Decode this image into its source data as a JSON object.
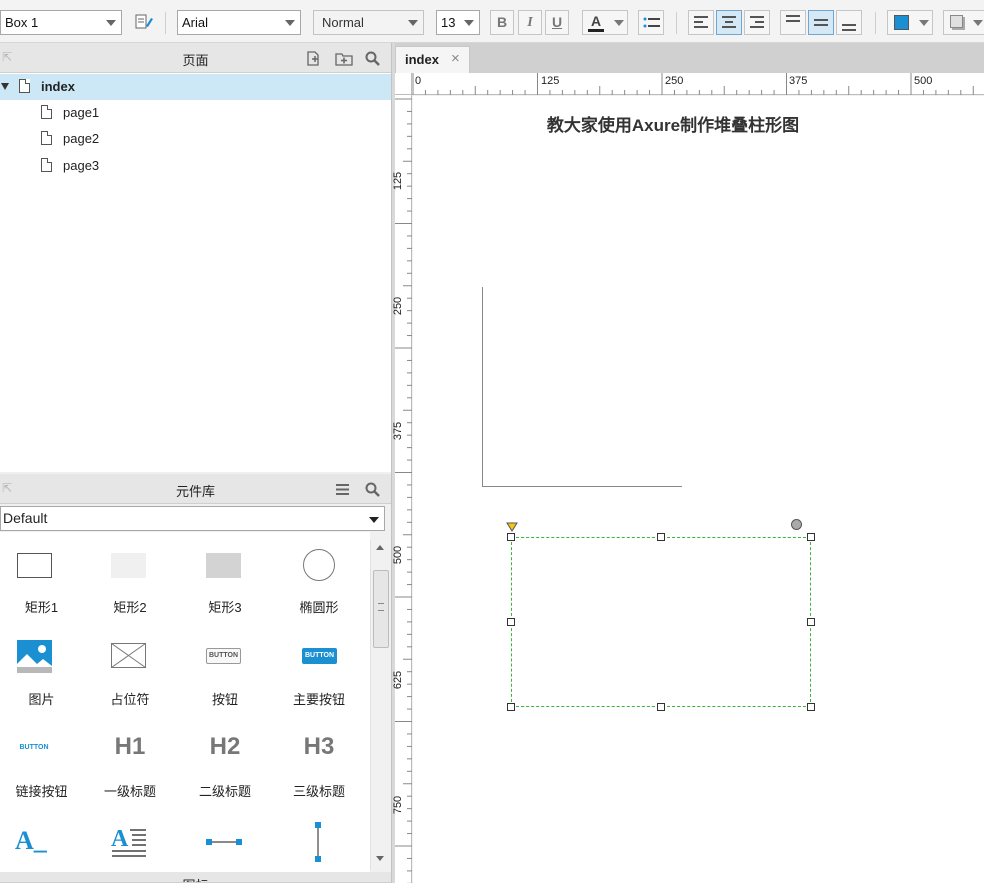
{
  "toolbar": {
    "widget_name": "Box 1",
    "font_family": "Arial",
    "font_style": "Normal",
    "font_size": "13",
    "bold": "B",
    "italic": "I",
    "underline": "U",
    "font_color": "A",
    "fill_color": "#1a8fd1"
  },
  "pages_panel": {
    "title": "页面",
    "root": "index",
    "children": [
      "page1",
      "page2",
      "page3"
    ]
  },
  "library_panel": {
    "title": "元件库",
    "selected_library": "Default",
    "widgets": [
      {
        "label": "矩形1",
        "icon": "rectangle-outline-icon"
      },
      {
        "label": "矩形2",
        "icon": "rectangle-light-icon"
      },
      {
        "label": "矩形3",
        "icon": "rectangle-gray-icon"
      },
      {
        "label": "椭圆形",
        "icon": "ellipse-icon"
      },
      {
        "label": "图片",
        "icon": "image-icon"
      },
      {
        "label": "占位符",
        "icon": "placeholder-icon"
      },
      {
        "label": "按钮",
        "icon": "button-icon",
        "icon_text": "BUTTON"
      },
      {
        "label": "主要按钮",
        "icon": "primary-button-icon",
        "icon_text": "BUTTON"
      },
      {
        "label": "链接按钮",
        "icon": "link-button-icon",
        "icon_text": "BUTTON"
      },
      {
        "label": "一级标题",
        "icon": "h1-icon",
        "icon_text": "H1"
      },
      {
        "label": "二级标题",
        "icon": "h2-icon",
        "icon_text": "H2"
      },
      {
        "label": "三级标题",
        "icon": "h3-icon",
        "icon_text": "H3"
      },
      {
        "label": "",
        "icon": "text-label-icon",
        "icon_text": "A_"
      },
      {
        "label": "",
        "icon": "paragraph-icon",
        "icon_text": "A"
      },
      {
        "label": "",
        "icon": "horizontal-line-icon"
      },
      {
        "label": "",
        "icon": "vertical-line-icon"
      }
    ]
  },
  "bottom_panel": {
    "title": "图标"
  },
  "editor": {
    "tab_label": "index",
    "tab_close": "×",
    "ruler_top": [
      "0",
      "125",
      "250",
      "375",
      "500"
    ],
    "ruler_left": [
      "125",
      "250",
      "375",
      "500",
      "625",
      "750"
    ],
    "canvas_title": "教大家使用Axure制作堆叠柱形图"
  },
  "colors": {
    "selection_green": "#3cb43c",
    "accent_blue": "#1a8fd1",
    "selected_row": "#cce8f6"
  }
}
